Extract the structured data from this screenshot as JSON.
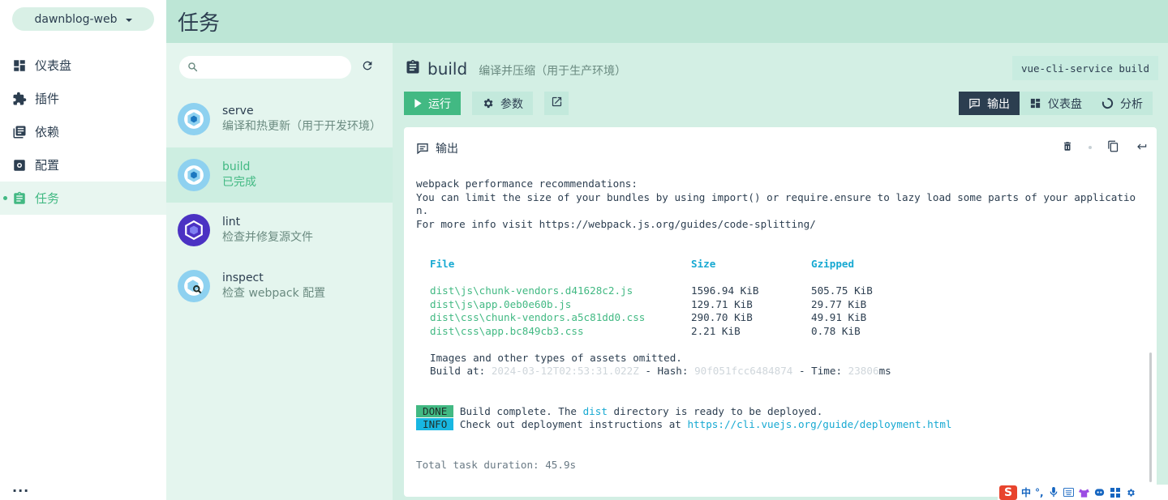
{
  "project": {
    "name": "dawnblog-web"
  },
  "sidebar": {
    "items": [
      {
        "label": "仪表盘",
        "icon": "dashboard-icon"
      },
      {
        "label": "插件",
        "icon": "puzzle-icon"
      },
      {
        "label": "依赖",
        "icon": "library-books-icon"
      },
      {
        "label": "配置",
        "icon": "settings-icon"
      },
      {
        "label": "任务",
        "icon": "clipboard-icon",
        "active": true
      }
    ],
    "more": "..."
  },
  "header": {
    "title": "任务"
  },
  "tasks": {
    "search_placeholder": "",
    "items": [
      {
        "name": "serve",
        "description": "编译和热更新（用于开发环境）"
      },
      {
        "name": "build",
        "description": "已完成",
        "active": true
      },
      {
        "name": "lint",
        "description": "检查并修复源文件"
      },
      {
        "name": "inspect",
        "description": "检查 webpack 配置"
      }
    ]
  },
  "task_detail": {
    "name": "build",
    "description": "编译并压缩（用于生产环境）",
    "command": "vue-cli-service build",
    "buttons": {
      "run": "运行",
      "params": "参数"
    },
    "views": [
      {
        "label": "输出",
        "icon": "message-icon",
        "active": true
      },
      {
        "label": "仪表盘",
        "icon": "dashboard-icon"
      },
      {
        "label": "分析",
        "icon": "donut-icon"
      }
    ]
  },
  "output": {
    "title": "输出",
    "recommend_1": "webpack performance recommendations:",
    "recommend_2": "You can limit the size of your bundles by using import() or require.ensure to lazy load some parts of your application.",
    "recommend_3": "For more info visit https://webpack.js.org/guides/code-splitting/",
    "table": {
      "headers": [
        "File",
        "Size",
        "Gzipped"
      ],
      "rows": [
        [
          "dist\\js\\chunk-vendors.d41628c2.js",
          "1596.94 KiB",
          "505.75 KiB"
        ],
        [
          "dist\\js\\app.0eb0e60b.js",
          "129.71 KiB",
          "29.77 KiB"
        ],
        [
          "dist\\css\\chunk-vendors.a5c81dd0.css",
          "290.70 KiB",
          "49.91 KiB"
        ],
        [
          "dist\\css\\app.bc849cb3.css",
          "2.21 KiB",
          "0.78 KiB"
        ]
      ]
    },
    "omitted": "Images and other types of assets omitted.",
    "build_at_label": "Build at: ",
    "build_at_value": "2024-03-12T02:53:31.022Z",
    "hash_label": " - Hash: ",
    "hash_value": "90f051fcc6484874",
    "time_label": " - Time: ",
    "time_value": "23806",
    "time_unit": "ms",
    "done_badge": "DONE",
    "done_text_1": " Build complete. The ",
    "done_text_dist": "dist",
    "done_text_2": " directory is ready to be deployed.",
    "info_badge": "INFO",
    "info_text": " Check out deployment instructions at ",
    "info_link": "https://cli.vuejs.org/guide/deployment.html",
    "duration": "Total task duration: 45.9s"
  },
  "ime": {
    "logo": "S",
    "lang": "中",
    "punct": "°,"
  },
  "colors": {
    "accent": "#42b983",
    "dark": "#2c3e50",
    "header": "#bde6d6",
    "panel": "#e4f5ee",
    "main": "#d3efe4",
    "info": "#18b7e2"
  }
}
